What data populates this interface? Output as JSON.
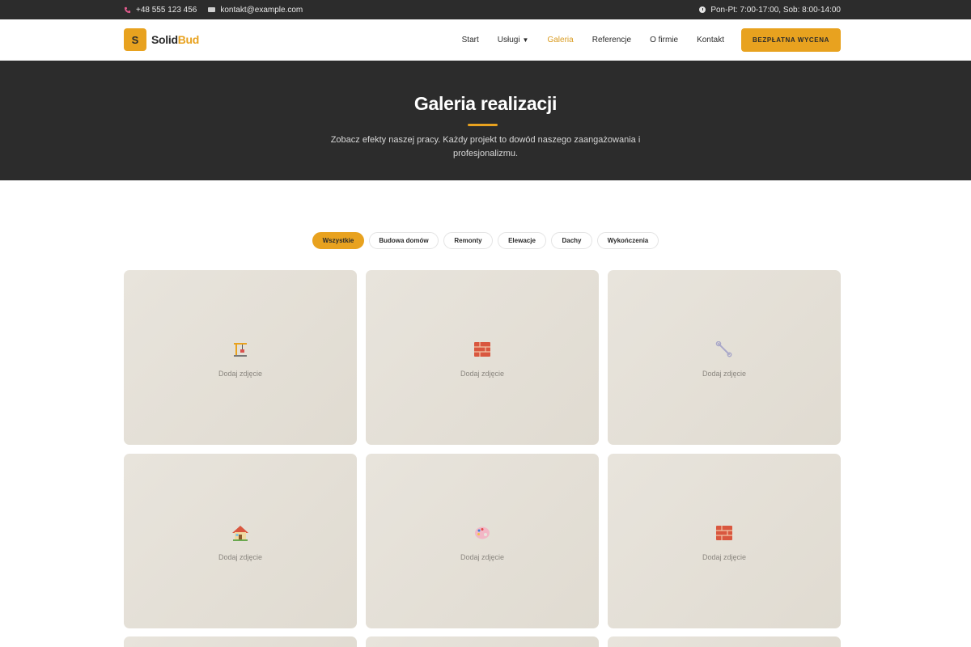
{
  "topbar": {
    "phone": "+48 555 123 456",
    "email": "kontakt@example.com",
    "hours": "Pon-Pt: 7:00-17:00, Sob: 8:00-14:00"
  },
  "brand": {
    "logo_letter": "S",
    "name_part1": "Solid",
    "name_part2": "Bud"
  },
  "nav": {
    "items": [
      {
        "label": "Start"
      },
      {
        "label": "Usługi"
      },
      {
        "label": "Galeria"
      },
      {
        "label": "Referencje"
      },
      {
        "label": "O firmie"
      },
      {
        "label": "Kontakt"
      }
    ],
    "active": "Galeria",
    "cta": "BEZPŁATNA WYCENA"
  },
  "hero": {
    "title": "Galeria realizacji",
    "subtitle": "Zobacz efekty naszej pracy. Każdy projekt to dowód naszego zaangażowania i profesjonalizmu."
  },
  "filters": [
    "Wszystkie",
    "Budowa domów",
    "Remonty",
    "Elewacje",
    "Dachy",
    "Wykończenia"
  ],
  "gallery": {
    "items": [
      {
        "icon": "crane-icon",
        "label": "Dodaj zdjęcie"
      },
      {
        "icon": "bricks-icon",
        "label": "Dodaj zdjęcie"
      },
      {
        "icon": "wrench-icon",
        "label": "Dodaj zdjęcie"
      },
      {
        "icon": "house-icon",
        "label": "Dodaj zdjęcie"
      },
      {
        "icon": "palette-icon",
        "label": "Dodaj zdjęcie"
      },
      {
        "icon": "bricks-icon",
        "label": "Dodaj zdjęcie"
      }
    ]
  },
  "colors": {
    "accent": "#e8a21f",
    "dark": "#2c2c2c",
    "card": "#e5e1d8"
  }
}
